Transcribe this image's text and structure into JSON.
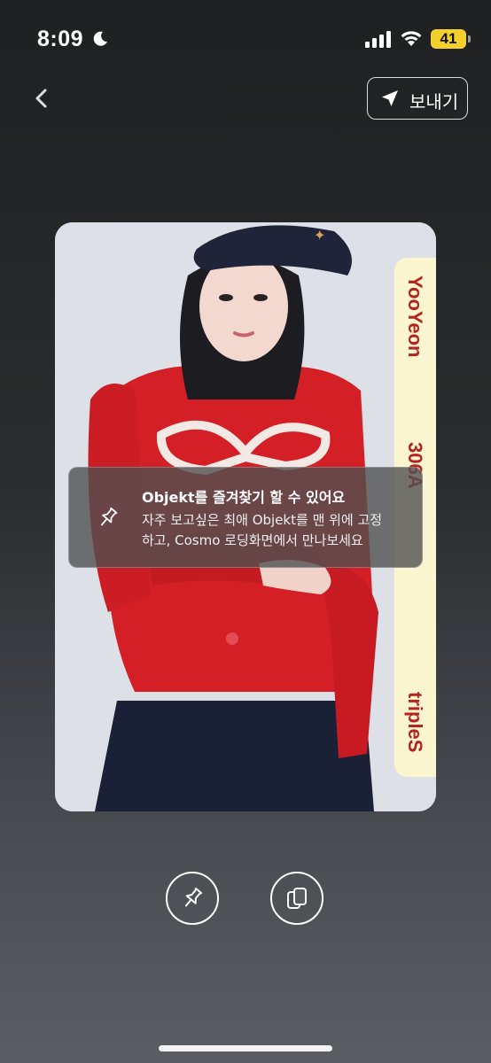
{
  "status_bar": {
    "time": "8:09",
    "battery": "41",
    "icons": [
      "moon-icon",
      "signal-icon",
      "wifi-icon",
      "battery-icon"
    ]
  },
  "nav": {
    "back_icon": "chevron-left-icon",
    "send_label": "보내기",
    "send_icon": "paper-plane-icon"
  },
  "card": {
    "member": "YooYeon",
    "code": "306A",
    "serial": "",
    "group": "tripleS",
    "strip_color": "#fbf5d0",
    "text_color": "#b4241f"
  },
  "tooltip": {
    "icon": "pin-icon",
    "title": "Objekt를 즐겨찾기 할 수 있어요",
    "body_line1": "자주 보고싶은 최애 Objekt를 맨 위에 고정",
    "body_line2": "하고, Cosmo 로딩화면에서 만나보세요"
  },
  "actions": {
    "pin_icon": "pin-icon",
    "copy_icon": "copy-icon"
  }
}
